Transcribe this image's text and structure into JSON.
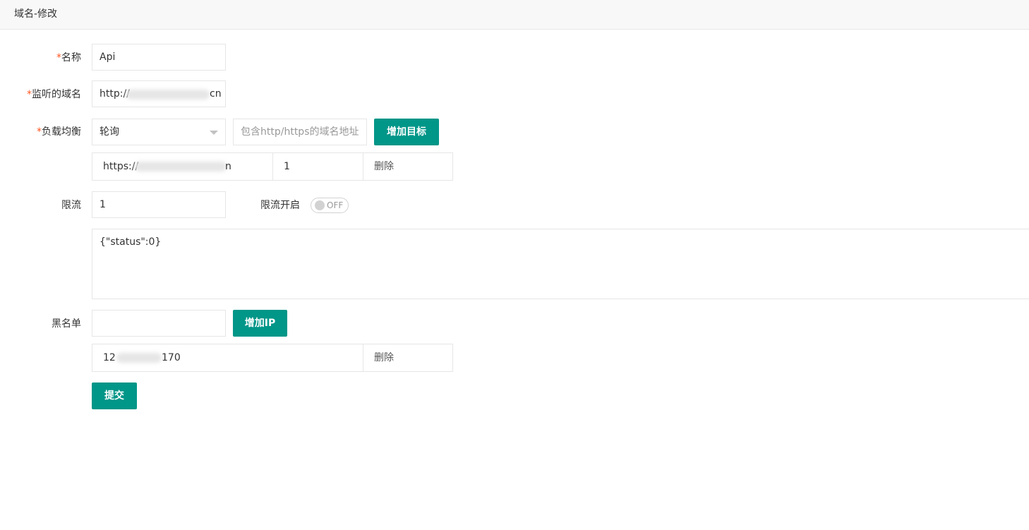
{
  "header": {
    "title": "域名-修改"
  },
  "form": {
    "name": {
      "label": "名称",
      "value": "Api"
    },
    "listen_domain": {
      "label": "监听的域名",
      "value_prefix": "http://",
      "value_suffix": "cn"
    },
    "load_balance": {
      "label": "负载均衡",
      "select_value": "轮询",
      "target_placeholder": "包含http/https的域名地址",
      "add_target_label": "增加目标",
      "targets": [
        {
          "url_prefix": "https://",
          "url_suffix": "n",
          "weight": "1",
          "delete_label": "删除"
        }
      ]
    },
    "rate_limit": {
      "label": "限流",
      "value": "1",
      "toggle_label": "限流开启",
      "toggle_state": "OFF",
      "response_text": "{\"status\":0}"
    },
    "blacklist": {
      "label": "黑名单",
      "add_ip_label": "增加IP",
      "entries": [
        {
          "ip_prefix": "12",
          "ip_suffix": "170",
          "delete_label": "删除"
        }
      ]
    },
    "submit_label": "提交"
  },
  "colors": {
    "primary": "#009688",
    "required": "#ff5722"
  }
}
